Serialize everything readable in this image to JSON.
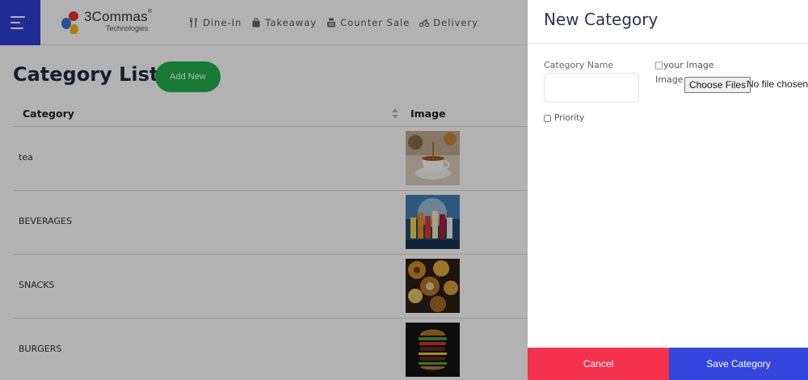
{
  "header": {
    "menu_icon": "hamburger-icon",
    "logo": {
      "name": "3Commas",
      "registered": "®",
      "tagline": "Technologies"
    },
    "nav": [
      {
        "label": "Dine-In",
        "icon": "fork-knife-icon"
      },
      {
        "label": "Takeaway",
        "icon": "bag-icon"
      },
      {
        "label": "Counter Sale",
        "icon": "register-icon"
      },
      {
        "label": "Delivery",
        "icon": "motorbike-icon"
      }
    ]
  },
  "main": {
    "title": "Category List",
    "add_button": "Add New",
    "table": {
      "columns": [
        "Category",
        "Image"
      ],
      "rows": [
        {
          "name": "tea",
          "image": "tea-cup-photo"
        },
        {
          "name": "BEVERAGES",
          "image": "beverages-photo"
        },
        {
          "name": "SNACKS",
          "image": "snacks-photo"
        },
        {
          "name": "BURGERS",
          "image": "burger-photo"
        }
      ]
    }
  },
  "panel": {
    "title": "New Category",
    "category_name_label": "Category Name",
    "category_name_value": "",
    "image_alt": "your Image",
    "image_label": "Image",
    "choose_files": "Choose Files",
    "file_status": "No file chosen",
    "priority_label": "Priority",
    "cancel": "Cancel",
    "save": "Save Category"
  },
  "colors": {
    "menu_bg": "#2f3fd6",
    "add_green": "#22b14c",
    "cancel_red": "#f5324e",
    "save_blue": "#3346dd"
  }
}
